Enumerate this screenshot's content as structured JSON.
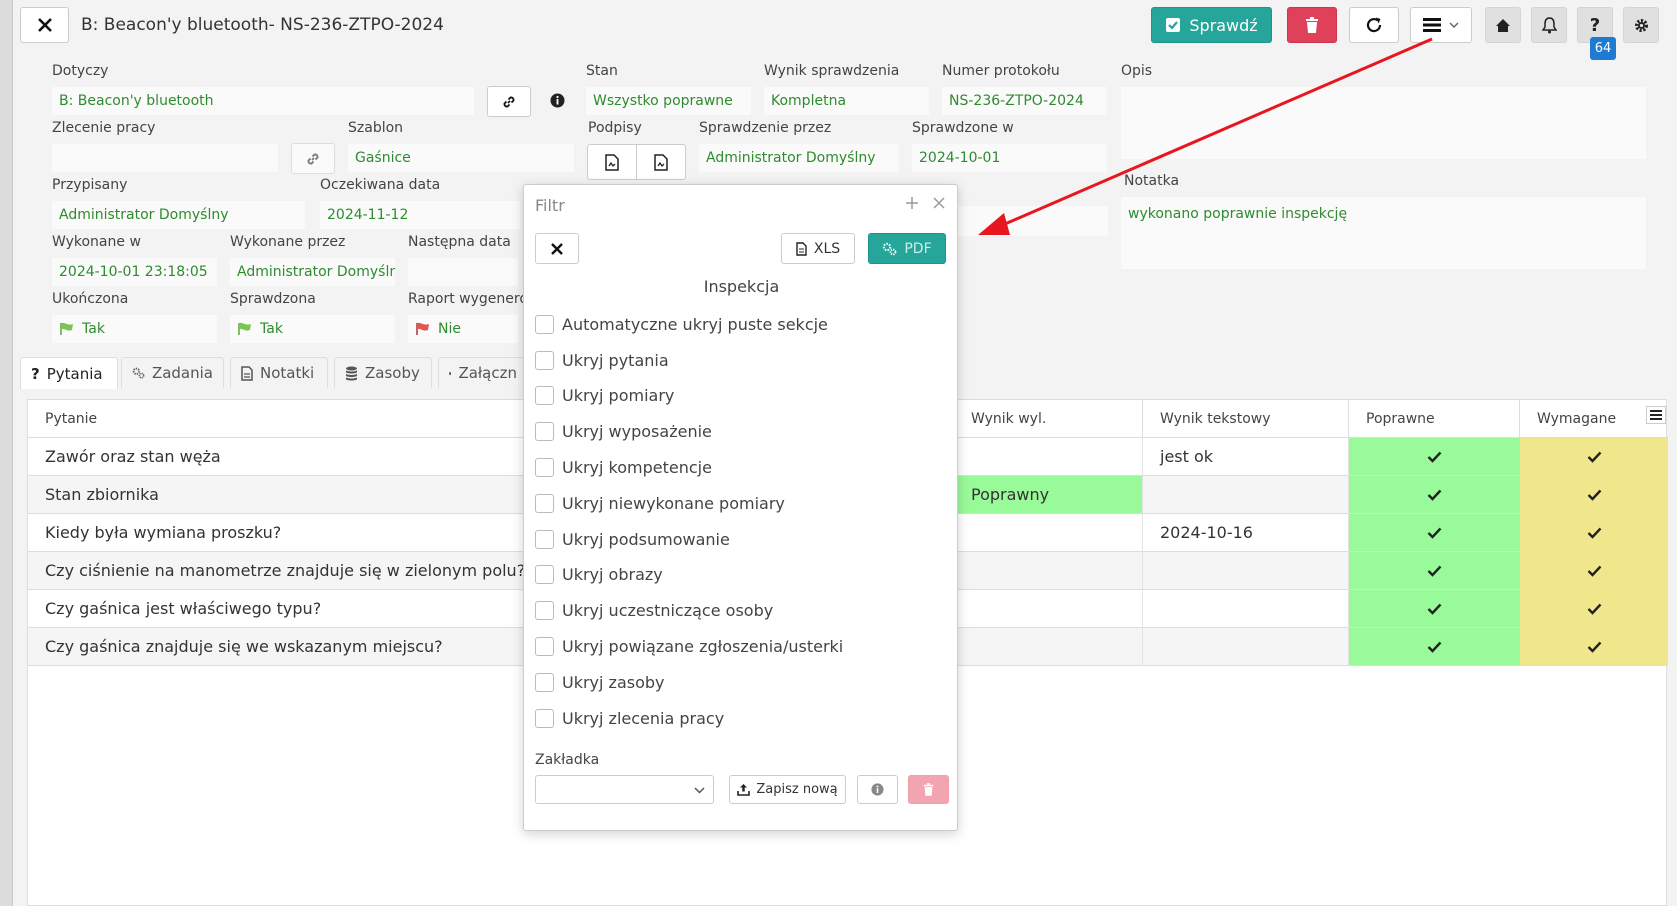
{
  "header": {
    "title": "B: Beacon'y bluetooth- NS-236-ZTPO-2024",
    "check_label": "Sprawdź",
    "notification_count": "64"
  },
  "fields": {
    "dotyczy_label": "Dotyczy",
    "dotyczy_value": "B: Beacon'y bluetooth",
    "stan_label": "Stan",
    "stan_value": "Wszystko poprawne",
    "wynik_label": "Wynik sprawdzenia",
    "wynik_value": "Kompletna",
    "numer_label": "Numer protokołu",
    "numer_value": "NS-236-ZTPO-2024",
    "opis_label": "Opis",
    "opis_value": "",
    "zlecenie_label": "Zlecenie pracy",
    "zlecenie_value": "",
    "szablon_label": "Szablon",
    "szablon_value": "Gaśnice",
    "podpisy_label": "Podpisy",
    "sprawdzenie_przez_label": "Sprawdzenie przez",
    "sprawdzenie_przez_value": "Administrator Domyślny",
    "sprawdzone_w_label": "Sprawdzone w",
    "sprawdzone_w_value": "2024-10-01",
    "przypisany_label": "Przypisany",
    "przypisany_value": "Administrator Domyślny",
    "oczekiwana_label": "Oczekiwana data",
    "oczekiwana_value": "2024-11-12",
    "notatka_label": "Notatka",
    "notatka_value": "wykonano poprawnie inspekcję",
    "wykonane_w_label": "Wykonane w",
    "wykonane_w_value": "2024-10-01 23:18:05",
    "wykonane_przez_label": "Wykonane przez",
    "wykonane_przez_value": "Administrator Domyśln",
    "nastepna_label": "Następna data",
    "nastepna_value": "",
    "ukonczona_label": "Ukończona",
    "ukonczona_value": "Tak",
    "sprawdzona_label": "Sprawdzona",
    "sprawdzona_value": "Tak",
    "raport_label": "Raport wygenerow",
    "raport_value": "Nie"
  },
  "tabs": [
    {
      "label": "Pytania"
    },
    {
      "label": "Zadania"
    },
    {
      "label": "Notatki"
    },
    {
      "label": "Zasoby"
    },
    {
      "label": "Załączn"
    }
  ],
  "table": {
    "headers": [
      "Pytanie",
      "Wynik wyl.",
      "Wynik tekstowy",
      "Poprawne",
      "Wymagane"
    ],
    "rows": [
      {
        "pytanie": "Zawór oraz stan węża",
        "wynik": "",
        "tekst": "jest ok"
      },
      {
        "pytanie": "Stan zbiornika",
        "wynik": "Poprawny",
        "tekst": ""
      },
      {
        "pytanie": "Kiedy była wymiana proszku?",
        "wynik": "",
        "tekst": "2024-10-16"
      },
      {
        "pytanie": "Czy ciśnienie na manometrze znajduje się w zielonym polu?",
        "wynik": "",
        "tekst": ""
      },
      {
        "pytanie": "Czy gaśnica jest właściwego typu?",
        "wynik": "",
        "tekst": ""
      },
      {
        "pytanie": "Czy gaśnica znajduje się we wskazanym miejscu?",
        "wynik": "",
        "tekst": ""
      }
    ]
  },
  "modal": {
    "title": "Filtr",
    "xls_label": "XLS",
    "pdf_label": "PDF",
    "section_title": "Inspekcja",
    "options": [
      "Automatyczne ukryj puste sekcje",
      "Ukryj pytania",
      "Ukryj pomiary",
      "Ukryj wyposażenie",
      "Ukryj kompetencje",
      "Ukryj niewykonane pomiary",
      "Ukryj podsumowanie",
      "Ukryj obrazy",
      "Ukryj uczestniczące osoby",
      "Ukryj powiązane zgłoszenia/usterki",
      "Ukryj zasoby",
      "Ukryj zlecenia pracy"
    ],
    "bookmark_label": "Zakładka",
    "bookmark_value": "",
    "save_new_label": "Zapisz nową"
  },
  "colors": {
    "primary_green": "#26a69a",
    "danger_red": "#e0415a",
    "value_green": "#2e8b2e",
    "row_green": "#99fa99",
    "row_yellow": "#f0e68c",
    "badge_blue": "#1e7bd1",
    "annotation_red": "#e8161e"
  }
}
